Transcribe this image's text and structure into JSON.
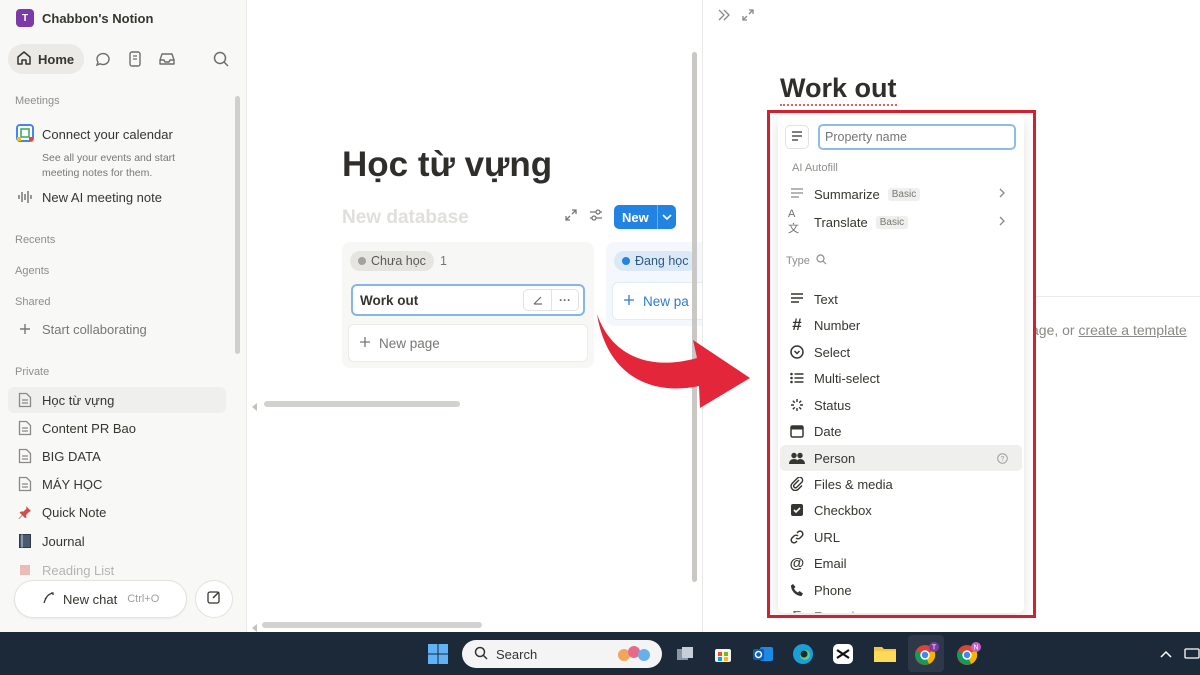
{
  "workspace": {
    "logo_letter": "T",
    "name": "Chabbon's Notion"
  },
  "nav": {
    "home_label": "Home"
  },
  "sidebar": {
    "meetings_heading": "Meetings",
    "calendar_title": "Connect your calendar",
    "calendar_desc": "See all your events and start meeting notes for them.",
    "ai_note": "New AI meeting note",
    "recents": "Recents",
    "agents": "Agents",
    "shared": "Shared",
    "start_collab": "Start collaborating",
    "private": "Private",
    "pages": [
      "Học từ vựng",
      "Content PR Bao",
      "BIG DATA",
      "MÁY HỌC",
      "Quick Note",
      "Journal",
      "Reading List"
    ],
    "new_chat": "New chat",
    "new_chat_shortcut": "Ctrl+O"
  },
  "main": {
    "page_title": "Học từ vựng",
    "db_title": "New database",
    "new_button": "New",
    "col1": {
      "status": "Chưa học",
      "count": "1",
      "card": "Work out",
      "new_page": "New page"
    },
    "col2": {
      "status": "Đang học",
      "new_page": "New pa"
    }
  },
  "peek": {
    "title": "Work out",
    "hint_prefix": "age, or ",
    "hint_link": "create a template"
  },
  "menu": {
    "placeholder": "Property name",
    "ai_heading": "AI Autofill",
    "ai_items": [
      {
        "label": "Summarize",
        "badge": "Basic"
      },
      {
        "label": "Translate",
        "badge": "Basic"
      }
    ],
    "type_heading": "Type",
    "types": [
      "Text",
      "Number",
      "Select",
      "Multi-select",
      "Status",
      "Date",
      "Person",
      "Files & media",
      "Checkbox",
      "URL",
      "Email",
      "Phone",
      "Formula"
    ],
    "highlight_index": 6
  },
  "taskbar": {
    "search_label": "Search"
  },
  "colors": {
    "accent": "#2383e2",
    "highlight_box": "#d1202e",
    "arrow": "#e4263a",
    "taskbar": "#1c2939"
  }
}
